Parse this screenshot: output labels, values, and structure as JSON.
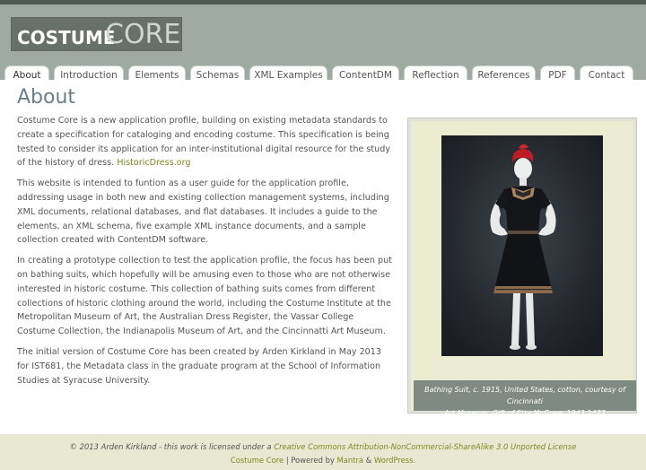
{
  "logo": {
    "part1": "COSTUME",
    "part2": "CORE"
  },
  "nav": {
    "items": [
      "About",
      "Introduction",
      "Elements",
      "Schemas",
      "XML Examples",
      "ContentDM",
      "Reflection",
      "References",
      "PDF",
      "Contact"
    ],
    "active": "About"
  },
  "page": {
    "title": "About",
    "p1_text": "Costume Core is a new application profile, building on existing metadata standards to create a specification for cataloging and encoding costume. This specification is being tested to consider its application for an inter-institutional digital resource for the study of the history of dress.",
    "p1_link": "HistoricDress.org",
    "p2": "This website is intended to funtion as  a user guide for the application profile, addressing usage in both new and existing collection management systems, including XML documents, relational databases, and flat databases. It includes a guide to the elements, an XML schema, five example XML instance documents, and a sample collection created with ContentDM software.",
    "p3": "In creating a prototype collection to test the application profile, the focus has been put on bathing suits, which hopefully will be amusing even to those who are not otherwise interested in historic costume. This collection of bathing suits comes from different collections of historic clothing around the world, including the Costume Institute at the Metropolitan Museum of Art, the Australian Dress Register, the Vassar College Costume Collection, the Indianapolis Museum of Art, and the Cincinnatti Art Museum.",
    "p4": "The initial version of Costume Core has been created by Arden Kirkland in May 2013 for IST681, the Metadata class in the graduate program at the School of Information Studies at Syracuse University."
  },
  "figure": {
    "caption_line1": "Bathing Suit, c. 1915, United States, cotton, courtesy of Cincinnati",
    "caption_line2": "Art Museum, Gift of Etta McGrew, 1943.1477"
  },
  "footer": {
    "row1_text": "© 2013 Arden Kirkland - this work is licensed under a",
    "row1_link": "Creative Commons Attribution-NonCommercial-ShareAlike 3.0 Unported License",
    "row2_link1": "Costume Core",
    "row2_sep": "| Powered by",
    "row2_link2": "Mantra",
    "row2_amp": "&",
    "row2_link3": "WordPress."
  },
  "colors": {
    "header": "#9faaa2",
    "accent_link": "#7f8722",
    "title": "#6d7f86",
    "footer_bg": "#e9e9d3"
  }
}
